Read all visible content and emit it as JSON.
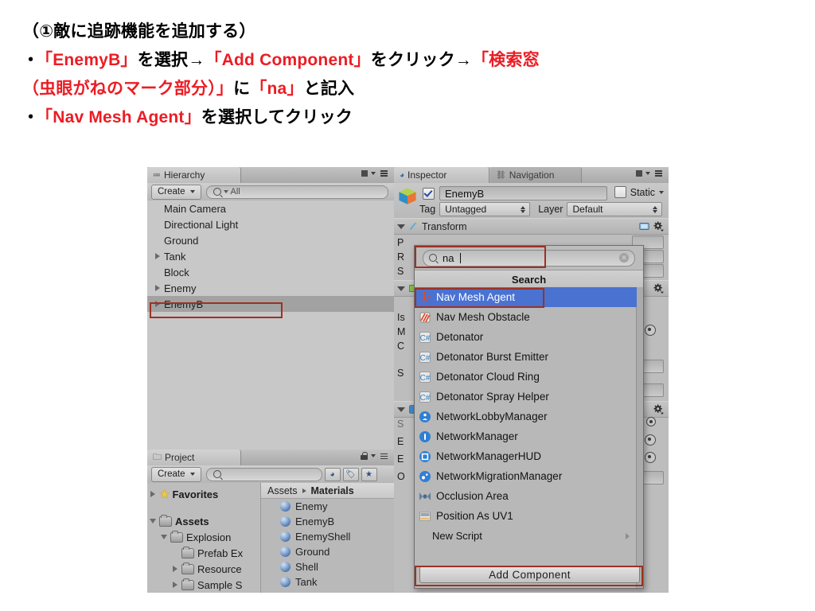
{
  "slide": {
    "heading": "（①敵に追跡機能を追加する）",
    "lines": [
      {
        "bullet": "・",
        "segments": [
          {
            "t": "「EnemyB」",
            "c": "red"
          },
          {
            "t": "を選択→",
            "c": "black"
          },
          {
            "t": "「Add Component」",
            "c": "red"
          },
          {
            "t": "をクリック→",
            "c": "black"
          },
          {
            "t": "「検索窓",
            "c": "red"
          }
        ]
      },
      {
        "bullet": "",
        "segments": [
          {
            "t": "（虫眼がねのマーク部分）」",
            "c": "red"
          },
          {
            "t": "に",
            "c": "black"
          },
          {
            "t": "「na」",
            "c": "red"
          },
          {
            "t": "と記入",
            "c": "black"
          }
        ]
      },
      {
        "bullet": "・",
        "segments": [
          {
            "t": "「Nav Mesh Agent」",
            "c": "red"
          },
          {
            "t": "を選択してクリック",
            "c": "black"
          }
        ]
      }
    ],
    "accent_red": "#ec1c24"
  },
  "unity": {
    "hierarchy": {
      "tab_label": "Hierarchy",
      "create_button": "Create",
      "search_placeholder": "All",
      "items": [
        {
          "label": "Main Camera",
          "expandable": false,
          "selected": false
        },
        {
          "label": "Directional Light",
          "expandable": false,
          "selected": false
        },
        {
          "label": "Ground",
          "expandable": false,
          "selected": false
        },
        {
          "label": "Tank",
          "expandable": true,
          "selected": false
        },
        {
          "label": "Block",
          "expandable": false,
          "selected": false
        },
        {
          "label": "Enemy",
          "expandable": true,
          "selected": false
        },
        {
          "label": "EnemyB",
          "expandable": true,
          "selected": true
        }
      ]
    },
    "project": {
      "tab_label": "Project",
      "create_button": "Create",
      "search_placeholder": "",
      "tree": [
        {
          "label": "Favorites",
          "type": "star",
          "indent": 0,
          "expandable": true,
          "bold": true
        },
        {
          "label": "Assets",
          "type": "folder",
          "indent": 0,
          "expandable": true,
          "bold": true,
          "expanded": true
        },
        {
          "label": "Explosion",
          "type": "folder",
          "indent": 1,
          "expandable": true,
          "bold": false,
          "expanded": true
        },
        {
          "label": "Prefab Ex",
          "type": "folder",
          "indent": 2,
          "expandable": false,
          "bold": false
        },
        {
          "label": "Resource",
          "type": "folder",
          "indent": 2,
          "expandable": true,
          "bold": false
        },
        {
          "label": "Sample S",
          "type": "folder",
          "indent": 2,
          "expandable": true,
          "bold": false
        }
      ],
      "breadcrumb": [
        "Assets",
        "Materials"
      ],
      "assets": [
        "Enemy",
        "EnemyB",
        "EnemyShell",
        "Ground",
        "Shell",
        "Tank"
      ]
    },
    "inspector": {
      "tab_label": "Inspector",
      "tab_label_2": "Navigation",
      "object_name": "EnemyB",
      "enabled": true,
      "static_label": "Static",
      "tag_label": "Tag",
      "tag_value": "Untagged",
      "layer_label": "Layer",
      "layer_value": "Default",
      "transform_label": "Transform",
      "partial_labels": [
        "P",
        "R",
        "S",
        "Is",
        "M",
        "C",
        "S",
        "S",
        "E",
        "E",
        "O"
      ]
    },
    "popup": {
      "search_value": "na",
      "search_icon": "search-icon",
      "title": "Search",
      "items": [
        {
          "label": "Nav Mesh Agent",
          "icon": "nav-mesh-agent-icon",
          "selected": true
        },
        {
          "label": "Nav Mesh Obstacle",
          "icon": "nav-mesh-obstacle-icon",
          "selected": false
        },
        {
          "label": "Detonator",
          "icon": "csharp-script-icon",
          "selected": false
        },
        {
          "label": "Detonator Burst Emitter",
          "icon": "csharp-script-icon",
          "selected": false
        },
        {
          "label": "Detonator Cloud Ring",
          "icon": "csharp-script-icon",
          "selected": false
        },
        {
          "label": "Detonator Spray Helper",
          "icon": "csharp-script-icon",
          "selected": false
        },
        {
          "label": "NetworkLobbyManager",
          "icon": "network-lobby-manager-icon",
          "selected": false
        },
        {
          "label": "NetworkManager",
          "icon": "network-manager-icon",
          "selected": false
        },
        {
          "label": "NetworkManagerHUD",
          "icon": "network-manager-hud-icon",
          "selected": false
        },
        {
          "label": "NetworkMigrationManager",
          "icon": "network-migration-manager-icon",
          "selected": false
        },
        {
          "label": "Occlusion Area",
          "icon": "occlusion-area-icon",
          "selected": false
        },
        {
          "label": "Position As UV1",
          "icon": "position-as-uv1-icon",
          "selected": false
        }
      ],
      "new_script_label": "New Script",
      "add_component_button": "Add Component",
      "highlight_color": "#4a72d0",
      "annotation_color": "#9c3222"
    }
  }
}
